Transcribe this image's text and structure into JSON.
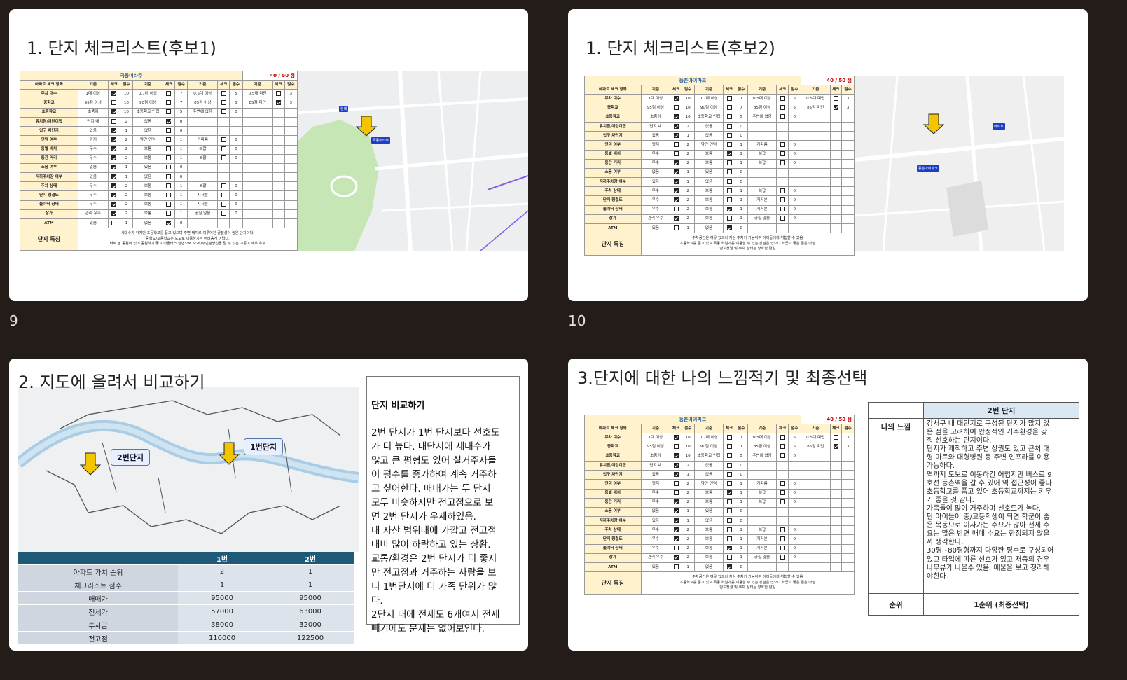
{
  "slides": {
    "s9": {
      "number": "9",
      "title": "1. 단지 체크리스트(후보1)"
    },
    "s10": {
      "number": "10",
      "title": "1. 단지 체크리스트(후보2)"
    },
    "s11": {
      "title": "2. 지도에 올려서 비교하기"
    },
    "s12": {
      "title": "3.단지에 대한 나의 느낌적기 및 최종선택"
    }
  },
  "checklist_header": [
    "아파트 체크 항목",
    "기준",
    "체크",
    "점수",
    "기준",
    "체크",
    "점수",
    "기준",
    "체크",
    "점수",
    "기준",
    "체크",
    "점수"
  ],
  "checklist1": {
    "name": "극동미라주",
    "score": "40 / 50 점",
    "rows": [
      [
        "주차 대수",
        "1대 이상",
        "1",
        "10",
        "0.7대 이상",
        "0",
        "7",
        "0.5대 이상",
        "0",
        "5",
        "0.5대 미만",
        "0",
        "3"
      ],
      [
        "중학교",
        "95점 이상",
        "0",
        "10",
        "90점 이상",
        "0",
        "7",
        "85점 이상",
        "0",
        "5",
        "85점 미만",
        "1",
        "3"
      ],
      [
        "초등학교",
        "초품아",
        "1",
        "10",
        "초등학교 인접",
        "0",
        "5",
        "주변에 없음",
        "0",
        "0",
        "",
        "",
        ""
      ],
      [
        "유치원/어린이집",
        "단지 내",
        "0",
        "2",
        "없음",
        "1",
        "0",
        "",
        "",
        "",
        "",
        "",
        ""
      ],
      [
        "입구 차단기",
        "있음",
        "1",
        "1",
        "없음",
        "0",
        "0",
        "",
        "",
        "",
        "",
        "",
        ""
      ],
      [
        "언덕 여부",
        "평지",
        "1",
        "2",
        "약간 언덕",
        "0",
        "1",
        "가파름",
        "0",
        "0",
        "",
        "",
        ""
      ],
      [
        "동별 배치",
        "우수",
        "1",
        "2",
        "보통",
        "0",
        "1",
        "복잡",
        "0",
        "0",
        "",
        "",
        ""
      ],
      [
        "동간 거리",
        "우수",
        "1",
        "2",
        "보통",
        "0",
        "1",
        "복잡",
        "0",
        "0",
        "",
        "",
        ""
      ],
      [
        "소음 여부",
        "없음",
        "1",
        "1",
        "있음",
        "0",
        "0",
        "",
        "",
        "",
        "",
        "",
        ""
      ],
      [
        "지하주차장 여부",
        "있음",
        "1",
        "1",
        "없음",
        "0",
        "0",
        "",
        "",
        "",
        "",
        "",
        ""
      ],
      [
        "주차 상태",
        "우수",
        "1",
        "2",
        "보통",
        "0",
        "1",
        "복잡",
        "0",
        "0",
        "",
        "",
        ""
      ],
      [
        "단지 청결도",
        "우수",
        "1",
        "2",
        "보통",
        "0",
        "1",
        "지저분",
        "0",
        "0",
        "",
        "",
        ""
      ],
      [
        "놀이터 상태",
        "우수",
        "1",
        "2",
        "보통",
        "0",
        "1",
        "지저분",
        "0",
        "0",
        "",
        "",
        ""
      ],
      [
        "상가",
        "관리 우수",
        "1",
        "2",
        "보통",
        "0",
        "1",
        "공실 많음",
        "0",
        "0",
        "",
        "",
        ""
      ],
      [
        "ATM",
        "있음",
        "0",
        "1",
        "없음",
        "1",
        "0",
        "",
        "",
        "",
        "",
        "",
        ""
      ]
    ],
    "feature_label": "단지 특징",
    "feature_lines": [
      "세대수가 작지만 초등학교를 품고 있으며 주변 택지로 이루어진 균질성이 높은 단지이다.",
      "중학교/고등학교는 도보로 이동하기는 어려움게 어렵다.",
      "바로 옆 공원이 있어 공원하기 좋고 마을버스 한번으로 5/26/수인분당선을 탈 수 있는 교통이 매우 우수"
    ]
  },
  "checklist2": {
    "name": "등촌아이파크",
    "score": "40 / 50 점",
    "rows": [
      [
        "주차 대수",
        "1대 이상",
        "1",
        "10",
        "0.7대 이상",
        "0",
        "7",
        "0.5대 이상",
        "0",
        "5",
        "0.5대 미만",
        "0",
        "3"
      ],
      [
        "중학교",
        "95점 이상",
        "0",
        "10",
        "90점 이상",
        "0",
        "7",
        "85점 이상",
        "0",
        "5",
        "85점 미만",
        "1",
        "3"
      ],
      [
        "초등학교",
        "초품아",
        "1",
        "10",
        "초등학교 인접",
        "0",
        "5",
        "주변에 없음",
        "0",
        "0",
        "",
        "",
        ""
      ],
      [
        "유치원/어린이집",
        "단지 내",
        "1",
        "2",
        "없음",
        "0",
        "0",
        "",
        "",
        "",
        "",
        "",
        ""
      ],
      [
        "입구 차단기",
        "있음",
        "1",
        "1",
        "없음",
        "0",
        "0",
        "",
        "",
        "",
        "",
        "",
        ""
      ],
      [
        "언덕 여부",
        "평지",
        "0",
        "2",
        "약간 언덕",
        "0",
        "1",
        "가파름",
        "0",
        "0",
        "",
        "",
        ""
      ],
      [
        "동별 배치",
        "우수",
        "0",
        "2",
        "보통",
        "1",
        "1",
        "복잡",
        "0",
        "0",
        "",
        "",
        ""
      ],
      [
        "동간 거리",
        "우수",
        "1",
        "2",
        "보통",
        "0",
        "1",
        "복잡",
        "0",
        "0",
        "",
        "",
        ""
      ],
      [
        "소음 여부",
        "없음",
        "1",
        "1",
        "있음",
        "0",
        "0",
        "",
        "",
        "",
        "",
        "",
        ""
      ],
      [
        "지하주차장 여부",
        "있음",
        "1",
        "1",
        "없음",
        "0",
        "0",
        "",
        "",
        "",
        "",
        "",
        ""
      ],
      [
        "주차 상태",
        "우수",
        "1",
        "2",
        "보통",
        "0",
        "1",
        "복잡",
        "0",
        "0",
        "",
        "",
        ""
      ],
      [
        "단지 청결도",
        "우수",
        "1",
        "2",
        "보통",
        "0",
        "1",
        "지저분",
        "0",
        "0",
        "",
        "",
        ""
      ],
      [
        "놀이터 상태",
        "우수",
        "0",
        "2",
        "보통",
        "1",
        "1",
        "지저분",
        "0",
        "0",
        "",
        "",
        ""
      ],
      [
        "상가",
        "관리 우수",
        "1",
        "2",
        "보통",
        "0",
        "1",
        "공실 많음",
        "0",
        "0",
        "",
        "",
        ""
      ],
      [
        "ATM",
        "있음",
        "0",
        "1",
        "없음",
        "1",
        "0",
        "",
        "",
        "",
        "",
        "",
        ""
      ]
    ],
    "feature_label": "단지 특징",
    "feature_lines": [
      "주차공간은 여유 있으나 지상 주차가 가능하여 아이들에게 위험할 수 있음",
      "초등학교를 품고 있고 목동 학원가를 이용할 수 있는 장점은 있으나 학군이 좋은 편은 아님",
      "단지청결 및 주차 상태는 양호한 편임"
    ]
  },
  "map1_labels": {
    "label_a": "현대",
    "label_b": "극동미라주"
  },
  "map2_labels": {
    "label_a": "등촌아이파크",
    "label_b": "아파트"
  },
  "seoul_map": {
    "label_1": "1번단지",
    "label_2": "2번단지"
  },
  "compare_table": {
    "headers": [
      "",
      "1번",
      "2번"
    ],
    "rows": [
      [
        "아파트 가치 순위",
        "2",
        "1"
      ],
      [
        "체크리스트 점수",
        "1",
        "1"
      ],
      [
        "매매가",
        "95000",
        "95000"
      ],
      [
        "전세가",
        "57000",
        "63000"
      ],
      [
        "투자금",
        "38000",
        "32000"
      ],
      [
        "전고점",
        "110000",
        "122500"
      ]
    ]
  },
  "compare_text": {
    "heading": "단지 비교하기",
    "lines": [
      "2번 단지가 1번 단지보다 선호도",
      "가 더 높다. 대단지에 세대수가",
      "많고 큰 평형도 있어 실거주자들",
      "이 평수를 증가하여 계속 거주하",
      "고 싶어한다. 매매가는 두 단지",
      "모두 비슷하지만 전고점으로 보",
      "면 2번 단지가 우세하였음.",
      "내 자산 범위내에 가깝고 전고점",
      "대비 많이 하락하고 있는 상황.",
      "교통/환경은 2번 단지가 더 좋지",
      "만 전고점과 거주하는 사람을 보",
      "니 1번단지에 더 가족 단위가 많",
      "다.",
      "2단지 내에 전세도 6개여서 전세",
      "빼기에도 문제는 없어보인다."
    ]
  },
  "feeling_table": {
    "header": "2번 단지",
    "row_label": "나의 느낌",
    "lines": [
      "강서구 내 대단지로 구성된 단지가 많지 않",
      "은 점을 고려하여 안정적인 거주환경을 갖",
      "춰 선호하는 단지이다.",
      "단지가 쾌적하고 주변 상권도 있고 근처 대",
      "형 마트와 대형병원 등 주변 인프라를 이용",
      "가능하다.",
      "역까지 도보로 이동하긴 어렵지만 버스로 9",
      "호선 등촌역을 갈 수 있어 역 접근성이 좋다.",
      "초등학교를 품고 있어 초등학교까지는 키우",
      "기 좋을 것 같다.",
      "가족들이 많이 거주하며 선호도가 높다.",
      "단 아이들이 중/고등학생이 되면 학군이 좋",
      "은 목동으로 이사가는 수요가 많아 전세 수",
      "요는 많은 반면 매매 수요는 한정되지 않을",
      "까 생각한다.",
      "30평~80평형까지 다양한 평수로 구성되어",
      "있고 타입에 따른 선호가 있고 저층의 경우",
      "나무뷰가 나올수 있음. 매물을 보고 정리해",
      "야한다."
    ],
    "rank_label": "순위",
    "rank_value": "1순위 (최종선택)"
  },
  "colors": {
    "header_yellow": "#fff2cc",
    "table_blue": "#1e5a78",
    "arrow_yellow": "#f5c400",
    "park_green": "#bfe3b0"
  }
}
